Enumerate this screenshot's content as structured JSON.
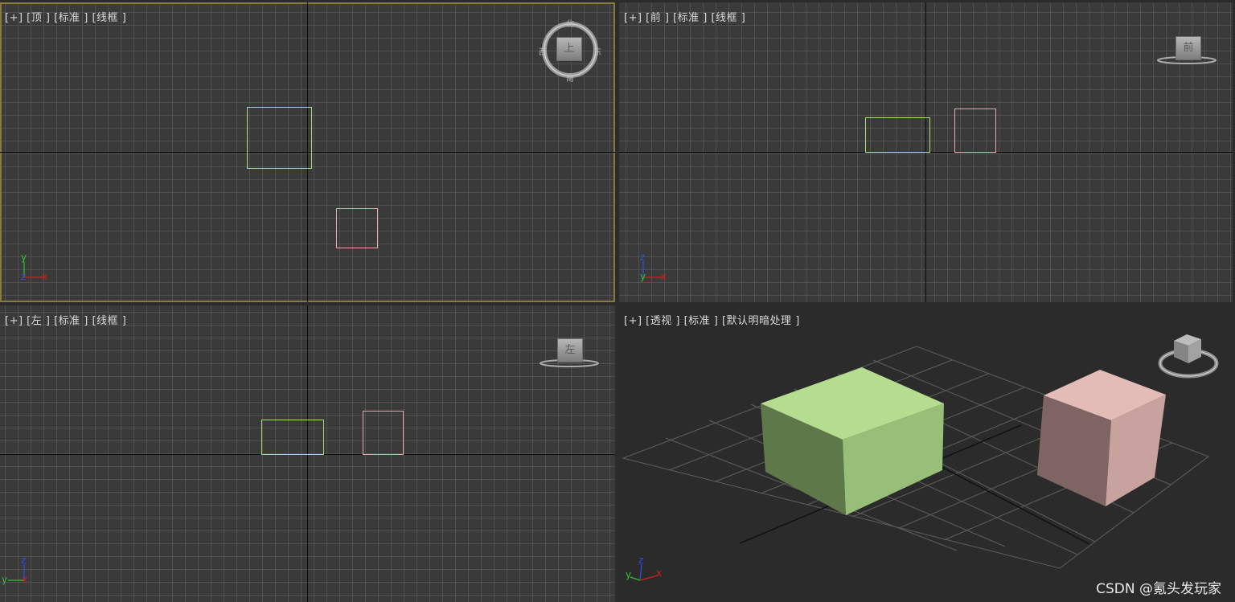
{
  "viewports": {
    "top": {
      "label": "[+] [顶 ] [标准 ] [线框 ]",
      "compass": {
        "north": "北",
        "south": "南",
        "east": "东",
        "west": "西",
        "face": "上"
      }
    },
    "front": {
      "label": "[+] [前 ] [标准 ] [线框 ]",
      "cube_face": "前"
    },
    "left": {
      "label": "[+] [左 ] [标准 ] [线框 ]",
      "cube_face": "左"
    },
    "perspective": {
      "label": "[+] [透视 ] [标准 ] [默认明暗处理 ]"
    }
  },
  "axis_labels": {
    "x": "x",
    "y": "y",
    "z": "z"
  },
  "colors": {
    "green_object": "#b5dc8f",
    "pink_object": "#e0b8b4",
    "active_border": "#8a7a3c",
    "axis_x": "#d02020",
    "axis_y": "#30c030",
    "axis_z": "#3050e0"
  },
  "watermark": "CSDN @氪头发玩家"
}
